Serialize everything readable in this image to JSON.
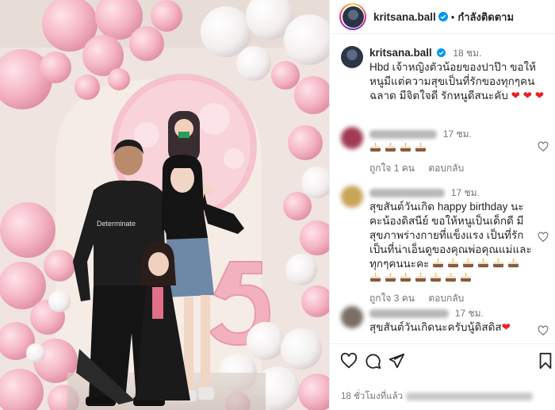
{
  "header": {
    "username": "kritsana.ball",
    "dot": "•",
    "follow_state": "กำลังติดตาม"
  },
  "caption": {
    "username": "kritsana.ball",
    "time": "18 ชม.",
    "text": "Hbd เจ้าหญิงตัวน้อยของปาป๊า ขอให้หนูมีแต่ความสุขเป็นที่รักของทุกๆคน ฉลาด มีจิตใจดี รักหนูดีสนะคับ"
  },
  "comments": [
    {
      "time": "17 ชม.",
      "cakes": 4,
      "text": "",
      "likes": "ถูกใจ 1 คน",
      "reply": "ตอบกลับ"
    },
    {
      "time": "17 ชม.",
      "cakes": 13,
      "text": "สุขสันต์วันเกิด happy birthday นะคะน้องดิสนีย์ ขอให้หนูเป็นเด็กดี มีสุขภาพร่างกายที่แข็งแรง เป็นที่รักเป็นที่น่าเอ็นดูของคุณพ่อคุณแม่และทุกๆคนนะคะ",
      "likes": "ถูกใจ 3 คน",
      "reply": "ตอบกลับ"
    },
    {
      "time": "17 ชม.",
      "cakes": 1,
      "text": "สุขสันต์วันเกิดนะครับนู้ดิสดิส"
    }
  ],
  "footer": {
    "posted_ago": "18 ชั่วโมงที่แล้ว"
  },
  "colors": {
    "accent_red": "#ed1d24",
    "muted": "#737373",
    "text": "#262626",
    "balloon_pink": "#f3b9c5",
    "balloon_white": "#f6f2f2"
  }
}
